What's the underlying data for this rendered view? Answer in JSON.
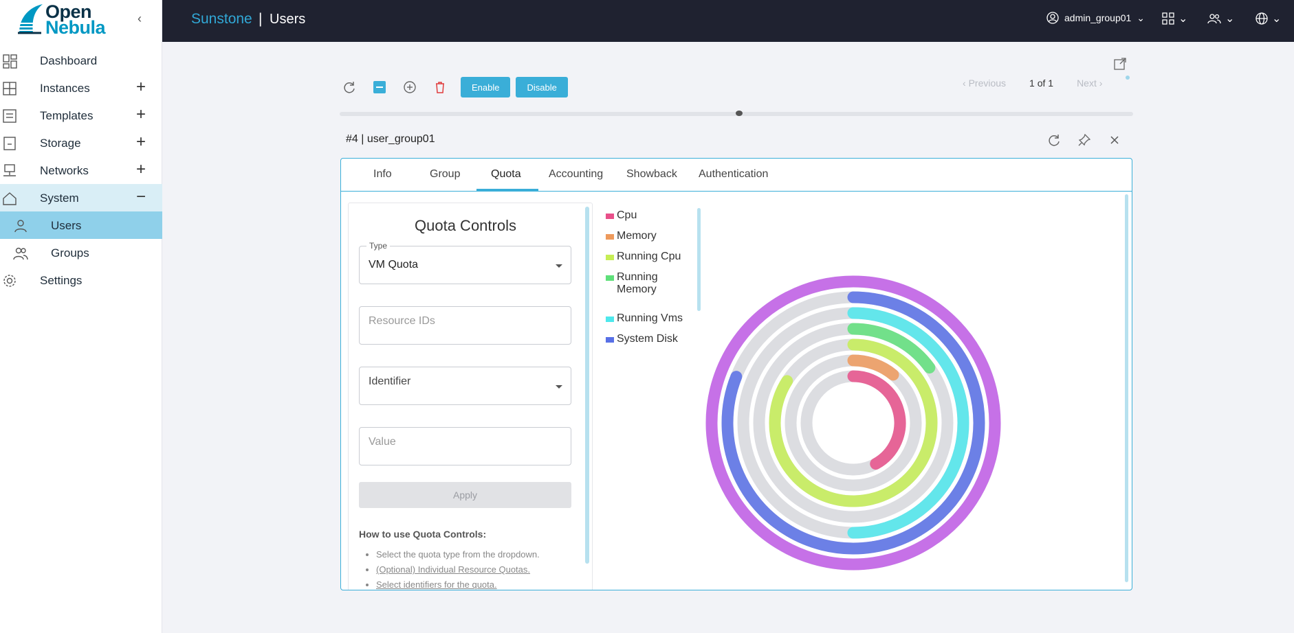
{
  "brand": {
    "open": "Open",
    "nebula": "Nebula"
  },
  "sidebar": {
    "items": [
      {
        "label": "Dashboard"
      },
      {
        "label": "Instances",
        "expand": "+"
      },
      {
        "label": "Templates",
        "expand": "+"
      },
      {
        "label": "Storage",
        "expand": "+"
      },
      {
        "label": "Networks",
        "expand": "+"
      },
      {
        "label": "System",
        "expand": "−"
      },
      {
        "label": "Users"
      },
      {
        "label": "Groups"
      },
      {
        "label": "Settings"
      }
    ]
  },
  "topbar": {
    "app": "Sunstone",
    "separator": "|",
    "page": "Users",
    "user": "admin_group01"
  },
  "toolbar": {
    "enable_label": "Enable",
    "disable_label": "Disable"
  },
  "pager": {
    "previous": "Previous",
    "count": "1 of 1",
    "next": "Next"
  },
  "detail": {
    "title": "#4 | user_group01"
  },
  "tabs": [
    "Info",
    "Group",
    "Quota",
    "Accounting",
    "Showback",
    "Authentication"
  ],
  "quota": {
    "title": "Quota Controls",
    "type_label": "Type",
    "type_value": "VM Quota",
    "resource_ids_placeholder": "Resource IDs",
    "identifier_placeholder": "Identifier",
    "value_placeholder": "Value",
    "apply_label": "Apply",
    "howto_title": "How to use Quota Controls:",
    "howto": [
      "Select the quota type from the dropdown.",
      "(Optional) Individual Resource Quotas.",
      "Select identifiers for the quota."
    ]
  },
  "chart_data": {
    "type": "radial-bar",
    "legend": [
      "Cpu",
      "Memory",
      "Running Cpu",
      "Running Memory",
      "Running Vms",
      "System Disk"
    ],
    "colors": {
      "Cpu": "#e8508a",
      "Memory": "#ee9a5c",
      "Running Cpu": "#c6ee55",
      "Running Memory": "#5fe07a",
      "Running Vms": "#4ee8ec",
      "System Disk": "#5870e6",
      "Outer": "#c25ee8"
    },
    "rings": [
      {
        "name": "Cpu",
        "value": 0.42
      },
      {
        "name": "Memory",
        "value": 0.11
      },
      {
        "name": "Running Cpu",
        "value": 0.84
      },
      {
        "name": "Running Memory",
        "value": 0.15
      },
      {
        "name": "Running Vms",
        "value": 0.5
      },
      {
        "name": "System Disk",
        "value": 0.81
      },
      {
        "name": "Outer",
        "value": 1.0
      }
    ]
  }
}
